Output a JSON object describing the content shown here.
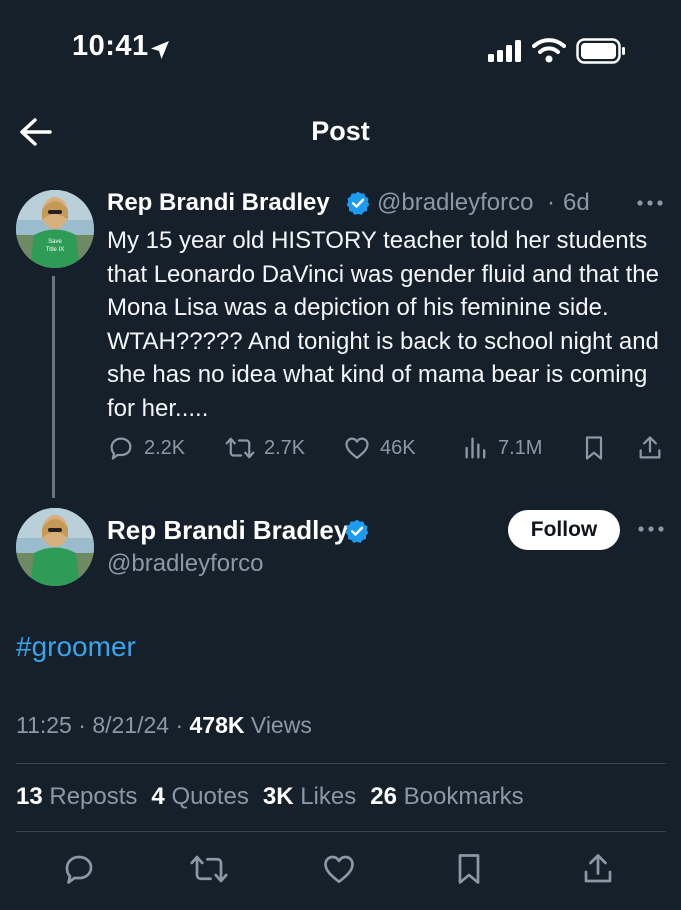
{
  "status_bar": {
    "time": "10:41"
  },
  "nav": {
    "title": "Post"
  },
  "parent_tweet": {
    "name": "Rep Brandi Bradley",
    "handle": "@bradleyforco",
    "separator": "·",
    "age": "6d",
    "text": "My 15 year old HISTORY teacher told her students that Leonardo DaVinci was gender fluid and that the Mona Lisa was a depiction of his feminine side. WTAH????? And tonight is back to school night and she has no idea what kind of mama bear is coming for her.....",
    "actions": {
      "replies": "2.2K",
      "reposts": "2.7K",
      "likes": "46K",
      "views": "7.1M"
    },
    "avatar_shirt_text": [
      "Save",
      "Title IX"
    ]
  },
  "main_tweet": {
    "name": "Rep Brandi Bradley",
    "handle": "@bradleyforco",
    "follow_label": "Follow",
    "hashtag": "#groomer",
    "time": "11:25",
    "date": "8/21/24",
    "views_count": "478K",
    "views_label": "Views",
    "stats": {
      "reposts_count": "13",
      "reposts_label": "Reposts",
      "quotes_count": "4",
      "quotes_label": "Quotes",
      "likes_count": "3K",
      "likes_label": "Likes",
      "bookmarks_count": "26",
      "bookmarks_label": "Bookmarks"
    }
  },
  "icons": [
    "location-arrow-icon",
    "signal-icon",
    "wifi-icon",
    "battery-icon",
    "back-arrow-icon",
    "verified-badge-icon",
    "more-icon",
    "reply-icon",
    "repost-icon",
    "like-icon",
    "views-icon",
    "bookmark-icon",
    "share-icon"
  ],
  "colors": {
    "background": "#15202b",
    "secondary_text": "#8b98a5",
    "link": "#3aa4ea",
    "verified": "#1d9bf0",
    "divider": "#38444d"
  }
}
